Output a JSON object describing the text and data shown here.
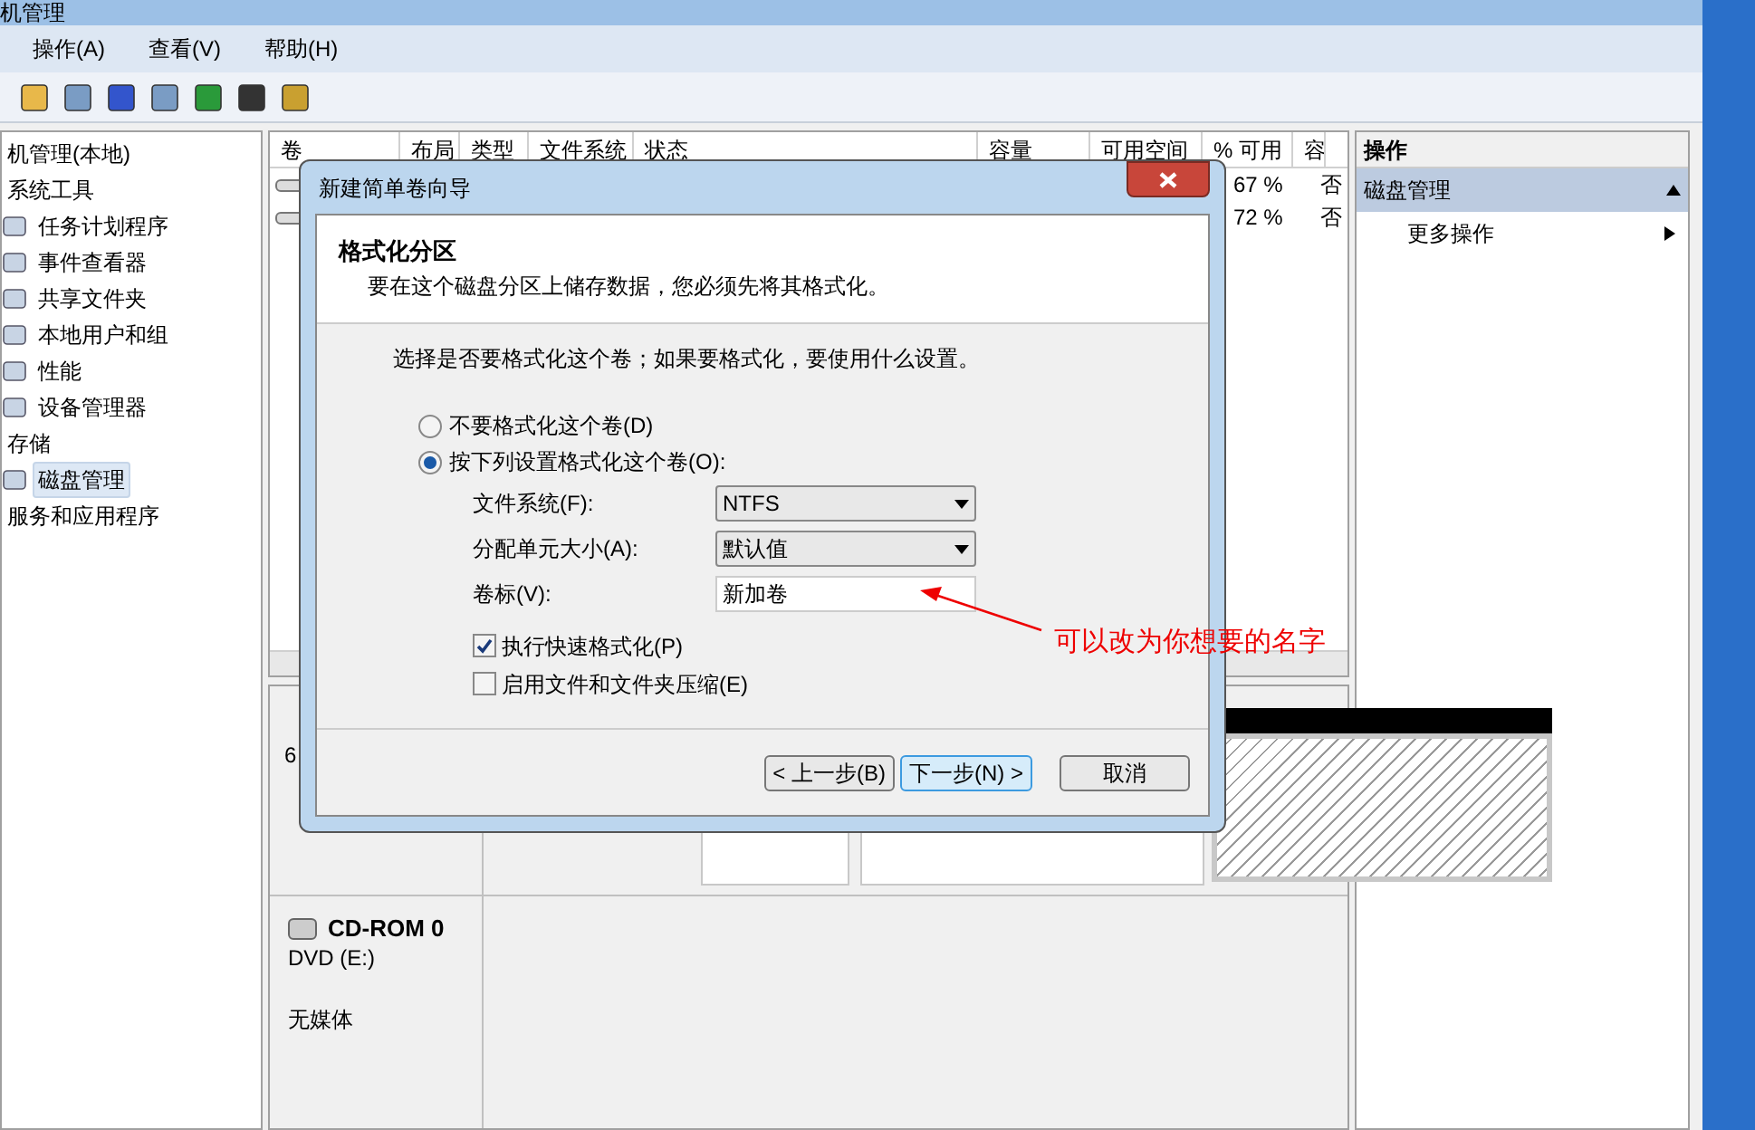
{
  "window": {
    "title": "机管理"
  },
  "menu": [
    "操作(A)",
    "查看(V)",
    "帮助(H)"
  ],
  "tree": [
    {
      "label": "机管理(本地)",
      "selected": false,
      "children": [
        {
          "label": "系统工具",
          "selected": false,
          "children": [
            {
              "label": "任务计划程序",
              "selected": false
            },
            {
              "label": "事件查看器",
              "selected": false
            },
            {
              "label": "共享文件夹",
              "selected": false
            },
            {
              "label": "本地用户和组",
              "selected": false
            },
            {
              "label": "性能",
              "selected": false
            },
            {
              "label": "设备管理器",
              "selected": false
            }
          ]
        },
        {
          "label": "存储",
          "selected": false,
          "children": [
            {
              "label": "磁盘管理",
              "selected": true
            }
          ]
        },
        {
          "label": "服务和应用程序",
          "selected": false
        }
      ]
    }
  ],
  "table": {
    "columns": [
      "卷",
      "布局",
      "类型",
      "文件系统",
      "状态",
      "容量",
      "可用空间",
      "% 可用",
      "容"
    ],
    "rows": [
      {
        "percent_free": "67 %",
        "column_9": "否"
      },
      {
        "percent_free": "72 %",
        "column_9": "否"
      }
    ]
  },
  "disks": [
    {
      "lines": [
        "6"
      ]
    },
    {
      "name": "CD-ROM 0",
      "type": "DVD (E:)",
      "status": "无媒体"
    }
  ],
  "actions": {
    "title": "操作",
    "section": {
      "label": "磁盘管理",
      "expanded": true
    },
    "items": [
      "更多操作"
    ]
  },
  "dialog": {
    "title": "新建简单卷向导",
    "heading": "格式化分区",
    "subtitle": "要在这个磁盘分区上储存数据，您必须先将其格式化。",
    "prompt": "选择是否要格式化这个卷；如果要格式化，要使用什么设置。",
    "radios": [
      {
        "label": "不要格式化这个卷(D)",
        "selected": false
      },
      {
        "label": "按下列设置格式化这个卷(O):",
        "selected": true
      }
    ],
    "fields": [
      {
        "kind": "select",
        "label": "文件系统(F):",
        "value": "NTFS"
      },
      {
        "kind": "select",
        "label": "分配单元大小(A):",
        "value": "默认值"
      },
      {
        "kind": "text",
        "label": "卷标(V):",
        "value": "新加卷"
      }
    ],
    "checkboxes": [
      {
        "label": "执行快速格式化(P)",
        "checked": true
      },
      {
        "label": "启用文件和文件夹压缩(E)",
        "checked": false
      }
    ],
    "buttons": [
      {
        "label": "< 上一步(B)",
        "default": false
      },
      {
        "label": "下一步(N) >",
        "default": true
      },
      {
        "label": "取消",
        "default": false
      }
    ]
  },
  "annotation": {
    "text": "可以改为你想要的名字"
  }
}
